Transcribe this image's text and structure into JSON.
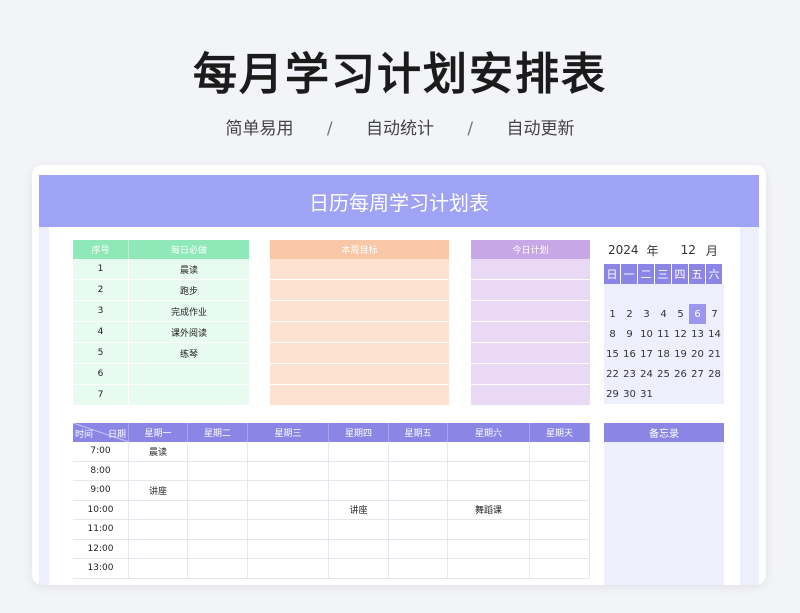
{
  "title": "每月学习计划安排表",
  "subtitle": {
    "items": [
      "简单易用",
      "自动统计",
      "自动更新"
    ],
    "separator": "/"
  },
  "sheet": {
    "banner": "日历每周学习计划表",
    "daily": {
      "headers": [
        "序号",
        "每日必做"
      ],
      "rows": [
        {
          "no": "1",
          "task": "晨读"
        },
        {
          "no": "2",
          "task": "跑步"
        },
        {
          "no": "3",
          "task": "完成作业"
        },
        {
          "no": "4",
          "task": "课外阅读"
        },
        {
          "no": "5",
          "task": "练琴"
        },
        {
          "no": "6",
          "task": ""
        },
        {
          "no": "7",
          "task": ""
        }
      ]
    },
    "weekly": {
      "header": "本周目标"
    },
    "today": {
      "header": "今日计划"
    },
    "calendar": {
      "year": "2024",
      "year_label": "年",
      "month": "12",
      "month_label": "月",
      "weekdays": [
        "日",
        "一",
        "二",
        "三",
        "四",
        "五",
        "六"
      ],
      "selected_day": "6",
      "days": [
        [
          "1",
          "2",
          "3",
          "4",
          "5",
          "6",
          "7"
        ],
        [
          "8",
          "9",
          "10",
          "11",
          "12",
          "13",
          "14"
        ],
        [
          "15",
          "16",
          "17",
          "18",
          "19",
          "20",
          "21"
        ],
        [
          "22",
          "23",
          "24",
          "25",
          "26",
          "27",
          "28"
        ],
        [
          "29",
          "30",
          "31",
          "",
          "",
          "",
          ""
        ]
      ]
    },
    "schedule": {
      "corner_time": "时间",
      "corner_date": "日期",
      "days": [
        "星期一",
        "星期二",
        "星期三",
        "星期四",
        "星期五",
        "星期六",
        "星期天"
      ],
      "rows": [
        {
          "time": "7:00",
          "cells": [
            "晨读",
            "",
            "",
            "",
            "",
            "",
            ""
          ]
        },
        {
          "time": "8:00",
          "cells": [
            "",
            "",
            "",
            "",
            "",
            "",
            ""
          ]
        },
        {
          "time": "9:00",
          "cells": [
            "讲座",
            "",
            "",
            "",
            "",
            "",
            ""
          ]
        },
        {
          "time": "10:00",
          "cells": [
            "",
            "",
            "",
            "讲座",
            "",
            "舞蹈课",
            ""
          ]
        },
        {
          "time": "11:00",
          "cells": [
            "",
            "",
            "",
            "",
            "",
            "",
            ""
          ]
        },
        {
          "time": "12:00",
          "cells": [
            "",
            "",
            "",
            "",
            "",
            "",
            ""
          ]
        },
        {
          "time": "13:00",
          "cells": [
            "",
            "",
            "",
            "",
            "",
            "",
            ""
          ]
        }
      ]
    },
    "memo": {
      "header": "备忘录"
    }
  }
}
